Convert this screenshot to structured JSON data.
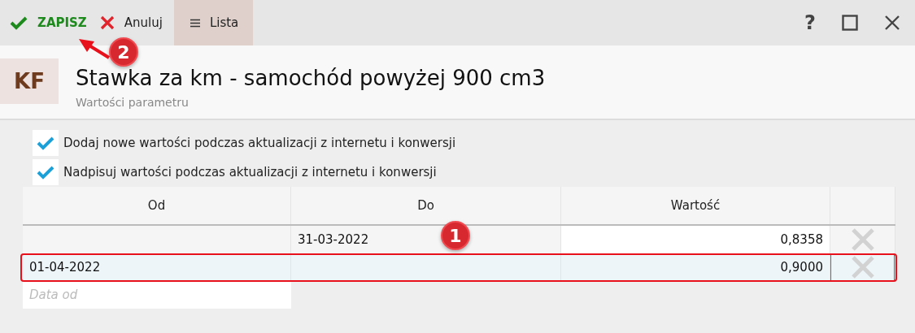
{
  "toolbar": {
    "buttons": [
      {
        "kind": "save",
        "label": "ZAPISZ",
        "selected": false
      },
      {
        "kind": "cancel",
        "label": "Anuluj",
        "selected": false
      },
      {
        "kind": "list",
        "label": "Lista",
        "selected": true
      }
    ],
    "window_controls": [
      {
        "kind": "help",
        "label": "?"
      },
      {
        "kind": "maximize"
      },
      {
        "kind": "close"
      }
    ]
  },
  "header": {
    "badge": "KF",
    "title": "Stawka za km - samochód powyżej 900 cm3",
    "subtitle": "Wartości parametru"
  },
  "options": [
    {
      "label": "Dodaj nowe wartości podczas aktualizacji z internetu i konwersji",
      "checked": true
    },
    {
      "label": "Nadpisuj wartości podczas aktualizacji z internetu i konwersji",
      "checked": true
    }
  ],
  "table": {
    "columns": [
      "Od",
      "Do",
      "Wartość"
    ],
    "rows": [
      {
        "od": "",
        "do": "31-03-2022",
        "wartosc": "0,8358",
        "selected": false
      },
      {
        "od": "01-04-2022",
        "do": "",
        "wartosc": "0,9000",
        "selected": true
      }
    ],
    "new_row": {
      "placeholder": "Data od"
    }
  },
  "annotations": [
    {
      "kind": "badge",
      "label": "2"
    },
    {
      "kind": "badge",
      "label": "1"
    }
  ]
}
